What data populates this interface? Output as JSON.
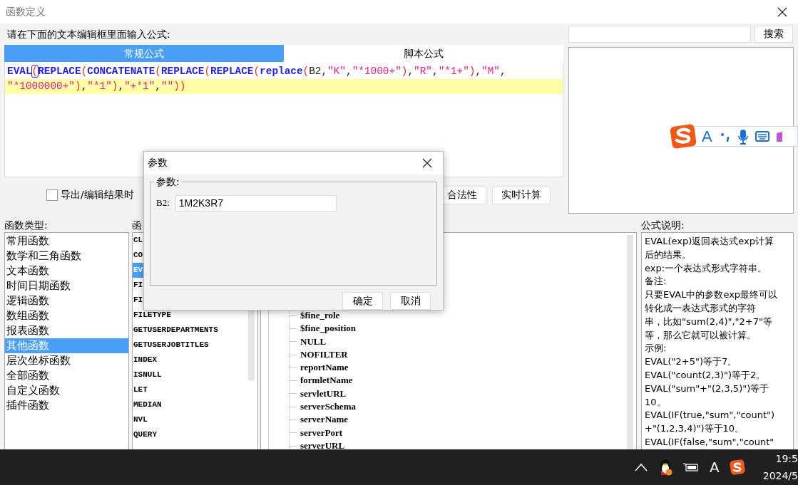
{
  "window": {
    "title": "函数定义"
  },
  "formula": {
    "prompt": "请在下面的文本编辑框里面输入公式:",
    "tabs": [
      {
        "label": "常规公式",
        "selected": true
      },
      {
        "label": "脚本公式",
        "selected": false
      }
    ],
    "lines": [
      {
        "current": false,
        "tokens": [
          {
            "kind": "func",
            "text": "EVAL"
          },
          {
            "kind": "paren",
            "text": "(",
            "matched": true
          },
          {
            "kind": "func",
            "text": "REPLACE"
          },
          {
            "kind": "paren",
            "text": "(",
            "matched": false
          },
          {
            "kind": "func",
            "text": "CONCATENATE"
          },
          {
            "kind": "paren",
            "text": "(",
            "matched": false
          },
          {
            "kind": "func",
            "text": "REPLACE"
          },
          {
            "kind": "paren",
            "text": "(",
            "matched": false
          },
          {
            "kind": "func",
            "text": "REPLACE"
          },
          {
            "kind": "paren",
            "text": "(",
            "matched": false
          },
          {
            "kind": "func",
            "text": "replace"
          },
          {
            "kind": "paren",
            "text": "(",
            "matched": false
          },
          {
            "kind": "plain",
            "text": "B2,"
          },
          {
            "kind": "string",
            "text": "\"K\""
          },
          {
            "kind": "plain",
            "text": ","
          },
          {
            "kind": "string",
            "text": "\"*1000+\""
          },
          {
            "kind": "paren",
            "text": ")",
            "matched": false
          },
          {
            "kind": "plain",
            "text": ","
          },
          {
            "kind": "string",
            "text": "\"R\""
          },
          {
            "kind": "plain",
            "text": ","
          },
          {
            "kind": "string",
            "text": "\"*1+\""
          },
          {
            "kind": "paren",
            "text": ")",
            "matched": false
          },
          {
            "kind": "plain",
            "text": ","
          },
          {
            "kind": "string",
            "text": "\"M\""
          },
          {
            "kind": "plain",
            "text": ","
          }
        ]
      },
      {
        "current": true,
        "tokens": [
          {
            "kind": "string",
            "text": "\"*1000000+\""
          },
          {
            "kind": "paren",
            "text": ")",
            "matched": false
          },
          {
            "kind": "plain",
            "text": ","
          },
          {
            "kind": "string",
            "text": "\"*1\""
          },
          {
            "kind": "paren",
            "text": ")",
            "matched": false
          },
          {
            "kind": "plain",
            "text": ","
          },
          {
            "kind": "string",
            "text": "\"+*1\""
          },
          {
            "kind": "plain",
            "text": ","
          },
          {
            "kind": "string",
            "text": "\"\""
          },
          {
            "kind": "paren",
            "text": "))",
            "matched": false
          }
        ]
      }
    ]
  },
  "options": {
    "checkbox": {
      "label": "导出/编辑结果时",
      "checked": false
    },
    "buttons": [
      "合法性",
      "实时计算"
    ]
  },
  "search": {
    "button": "搜索"
  },
  "function_types": {
    "label": "函数类型:",
    "items": [
      {
        "label": "常用函数",
        "selected": false
      },
      {
        "label": "数学和三角函数",
        "selected": false
      },
      {
        "label": "文本函数",
        "selected": false
      },
      {
        "label": "时间日期函数",
        "selected": false
      },
      {
        "label": "逻辑函数",
        "selected": false
      },
      {
        "label": "数组函数",
        "selected": false
      },
      {
        "label": "报表函数",
        "selected": false
      },
      {
        "label": "其他函数",
        "selected": true
      },
      {
        "label": "层次坐标函数",
        "selected": false
      },
      {
        "label": "全部函数",
        "selected": false
      },
      {
        "label": "自定义函数",
        "selected": false
      },
      {
        "label": "插件函数",
        "selected": false
      }
    ]
  },
  "functions": {
    "label": "函",
    "items": [
      {
        "label": "CL",
        "selected": false
      },
      {
        "label": "CO",
        "selected": false
      },
      {
        "label": "EV",
        "selected": true
      },
      {
        "label": "FI",
        "selected": false
      },
      {
        "label": "FI",
        "selected": false
      },
      {
        "label": "FILETYPE",
        "selected": false
      },
      {
        "label": "GETUSERDEPARTMENTS",
        "selected": false
      },
      {
        "label": "GETUSERJOBTITLES",
        "selected": false
      },
      {
        "label": "INDEX",
        "selected": false
      },
      {
        "label": "ISNULL",
        "selected": false
      },
      {
        "label": "LET",
        "selected": false
      },
      {
        "label": "MEDIAN",
        "selected": false
      },
      {
        "label": "NVL",
        "selected": false
      },
      {
        "label": "QUERY",
        "selected": false
      }
    ]
  },
  "tree": {
    "items": [
      "$fine_role",
      "$fine_position",
      "NULL",
      "NOFILTER",
      "reportName",
      "formletName",
      "servletURL",
      "serverSchema",
      "serverName",
      "serverPort",
      "serverURL"
    ]
  },
  "description": {
    "label": "公式说明:",
    "lines": [
      "EVAL(exp)返回表达式exp计算",
      "后的结果。",
      "exp:一个表达式形式字符串。",
      "备注:",
      "只要EVAL中的参数exp最终可以",
      "转化成一表达式形式的字符",
      "串，比如\"sum(2,4)\",\"2+7\"等",
      "等，那么它就可以被计算。",
      "示例:",
      "EVAL(\"2+5\")等于7。",
      "EVAL(\"count(2,3)\")等于2。",
      "EVAL(\"sum\"+\"(2,3,5)\")等于",
      "10。",
      "EVAL(IF(true,\"sum\",\"count\")",
      "+\"(1,2,3,4)\")等于10。",
      "EVAL(IF(false,\"sum\",\"count\""
    ]
  },
  "dialog": {
    "title": "参数",
    "group": "参数:",
    "fields": [
      {
        "label": "B2:",
        "value": "1M2K3R7"
      }
    ],
    "buttons": [
      "确定",
      "取消"
    ]
  },
  "ime_toolbar": {
    "mode": "A"
  },
  "taskbar": {
    "input_mode": "A",
    "time": "19:5",
    "date": "2024/5"
  }
}
